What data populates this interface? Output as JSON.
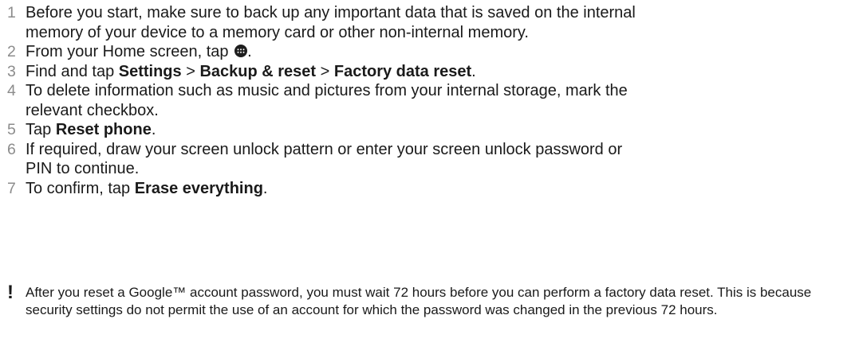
{
  "steps": [
    {
      "number": "1",
      "text": "Before you start, make sure to back up any important data that is saved on the internal memory of your device to a memory card or other non-internal memory."
    },
    {
      "number": "2",
      "text_before": "From your Home screen, tap ",
      "icon": "apps-grid-icon",
      "text_after": "."
    },
    {
      "number": "3",
      "text_before": "Find and tap ",
      "bold_1": "Settings",
      "sep_1": " > ",
      "bold_2": "Backup & reset",
      "sep_2": " > ",
      "bold_3": "Factory data reset",
      "text_after": "."
    },
    {
      "number": "4",
      "text": "To delete information such as music and pictures from your internal storage, mark the relevant checkbox."
    },
    {
      "number": "5",
      "text_before": "Tap ",
      "bold_1": "Reset phone",
      "text_after": "."
    },
    {
      "number": "6",
      "text": "If required, draw your screen unlock pattern or enter your screen unlock password or PIN to continue."
    },
    {
      "number": "7",
      "text_before": "To confirm, tap ",
      "bold_1": "Erase everything",
      "text_after": "."
    }
  ],
  "note": {
    "icon": "!",
    "text": "After you reset a Google™ account password, you must wait 72 hours before you can perform a factory data reset. This is because security settings do not permit the use of an account for which the password was changed in the previous 72 hours."
  }
}
